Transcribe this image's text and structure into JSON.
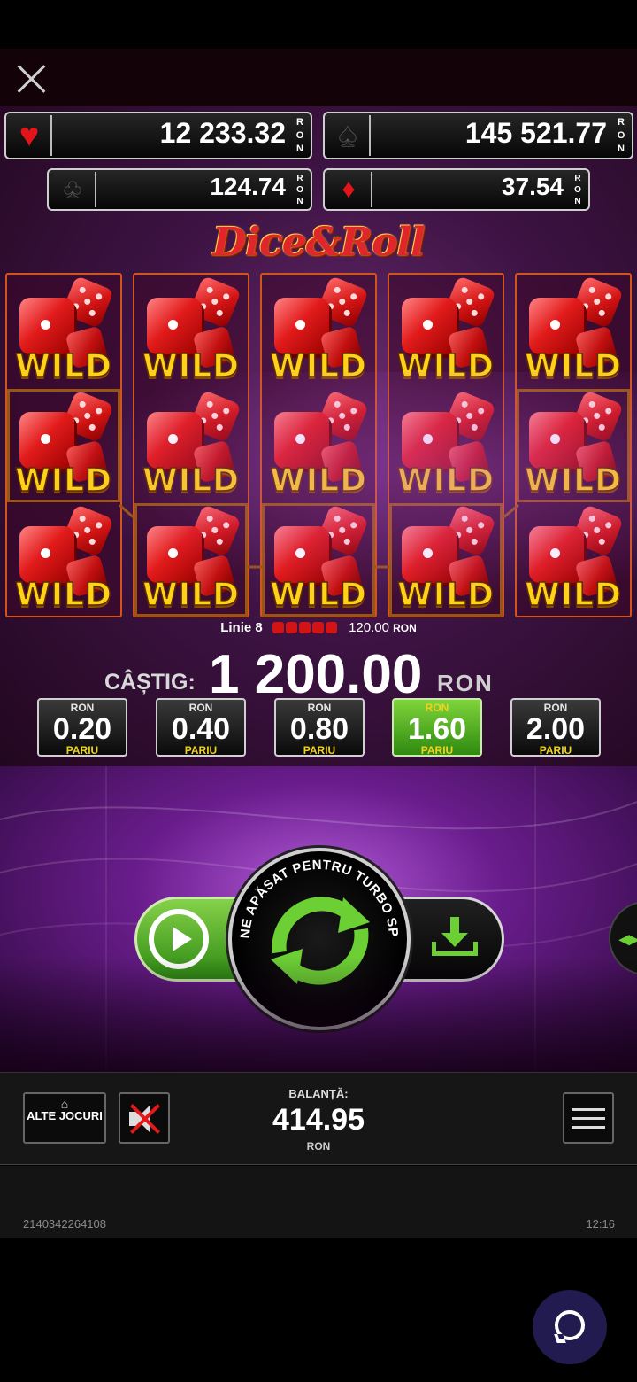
{
  "jackpots": {
    "hearts": {
      "value": "12 233.32",
      "currency": "RON"
    },
    "spades": {
      "value": "145 521.77",
      "currency": "RON"
    },
    "clubs": {
      "value": "124.74",
      "currency": "RON"
    },
    "diamonds": {
      "value": "37.54",
      "currency": "RON"
    }
  },
  "logo": "Dice&Roll",
  "reels": {
    "symbol_label": "WILD",
    "rows": 3,
    "columns": 5
  },
  "line_info": {
    "label": "Linie 8",
    "amount": "120.00",
    "currency": "RON"
  },
  "win": {
    "label": "CÂȘTIG:",
    "amount": "1 200.00",
    "currency": "RON"
  },
  "bets": [
    {
      "currency": "RON",
      "value": "0.20",
      "label": "PARIU",
      "active": false
    },
    {
      "currency": "RON",
      "value": "0.40",
      "label": "PARIU",
      "active": false
    },
    {
      "currency": "RON",
      "value": "0.80",
      "label": "PARIU",
      "active": false
    },
    {
      "currency": "RON",
      "value": "1.60",
      "label": "PARIU",
      "active": true
    },
    {
      "currency": "RON",
      "value": "2.00",
      "label": "PARIU",
      "active": false
    }
  ],
  "spin": {
    "hint": "ȚINE APĂSAT PENTRU TURBO SPIN"
  },
  "bottom": {
    "other_games": "ALTE JOCURI",
    "balance_label": "BALANȚĂ:",
    "balance_value": "414.95",
    "balance_currency": "RON"
  },
  "footer": {
    "session_id": "2140342264108",
    "time": "12:16"
  },
  "colors": {
    "accent_green": "#6ccf34",
    "wild_yellow": "#ffd21a",
    "dice_red": "#e21b1b",
    "bet_label_yellow": "#f3d21b"
  }
}
